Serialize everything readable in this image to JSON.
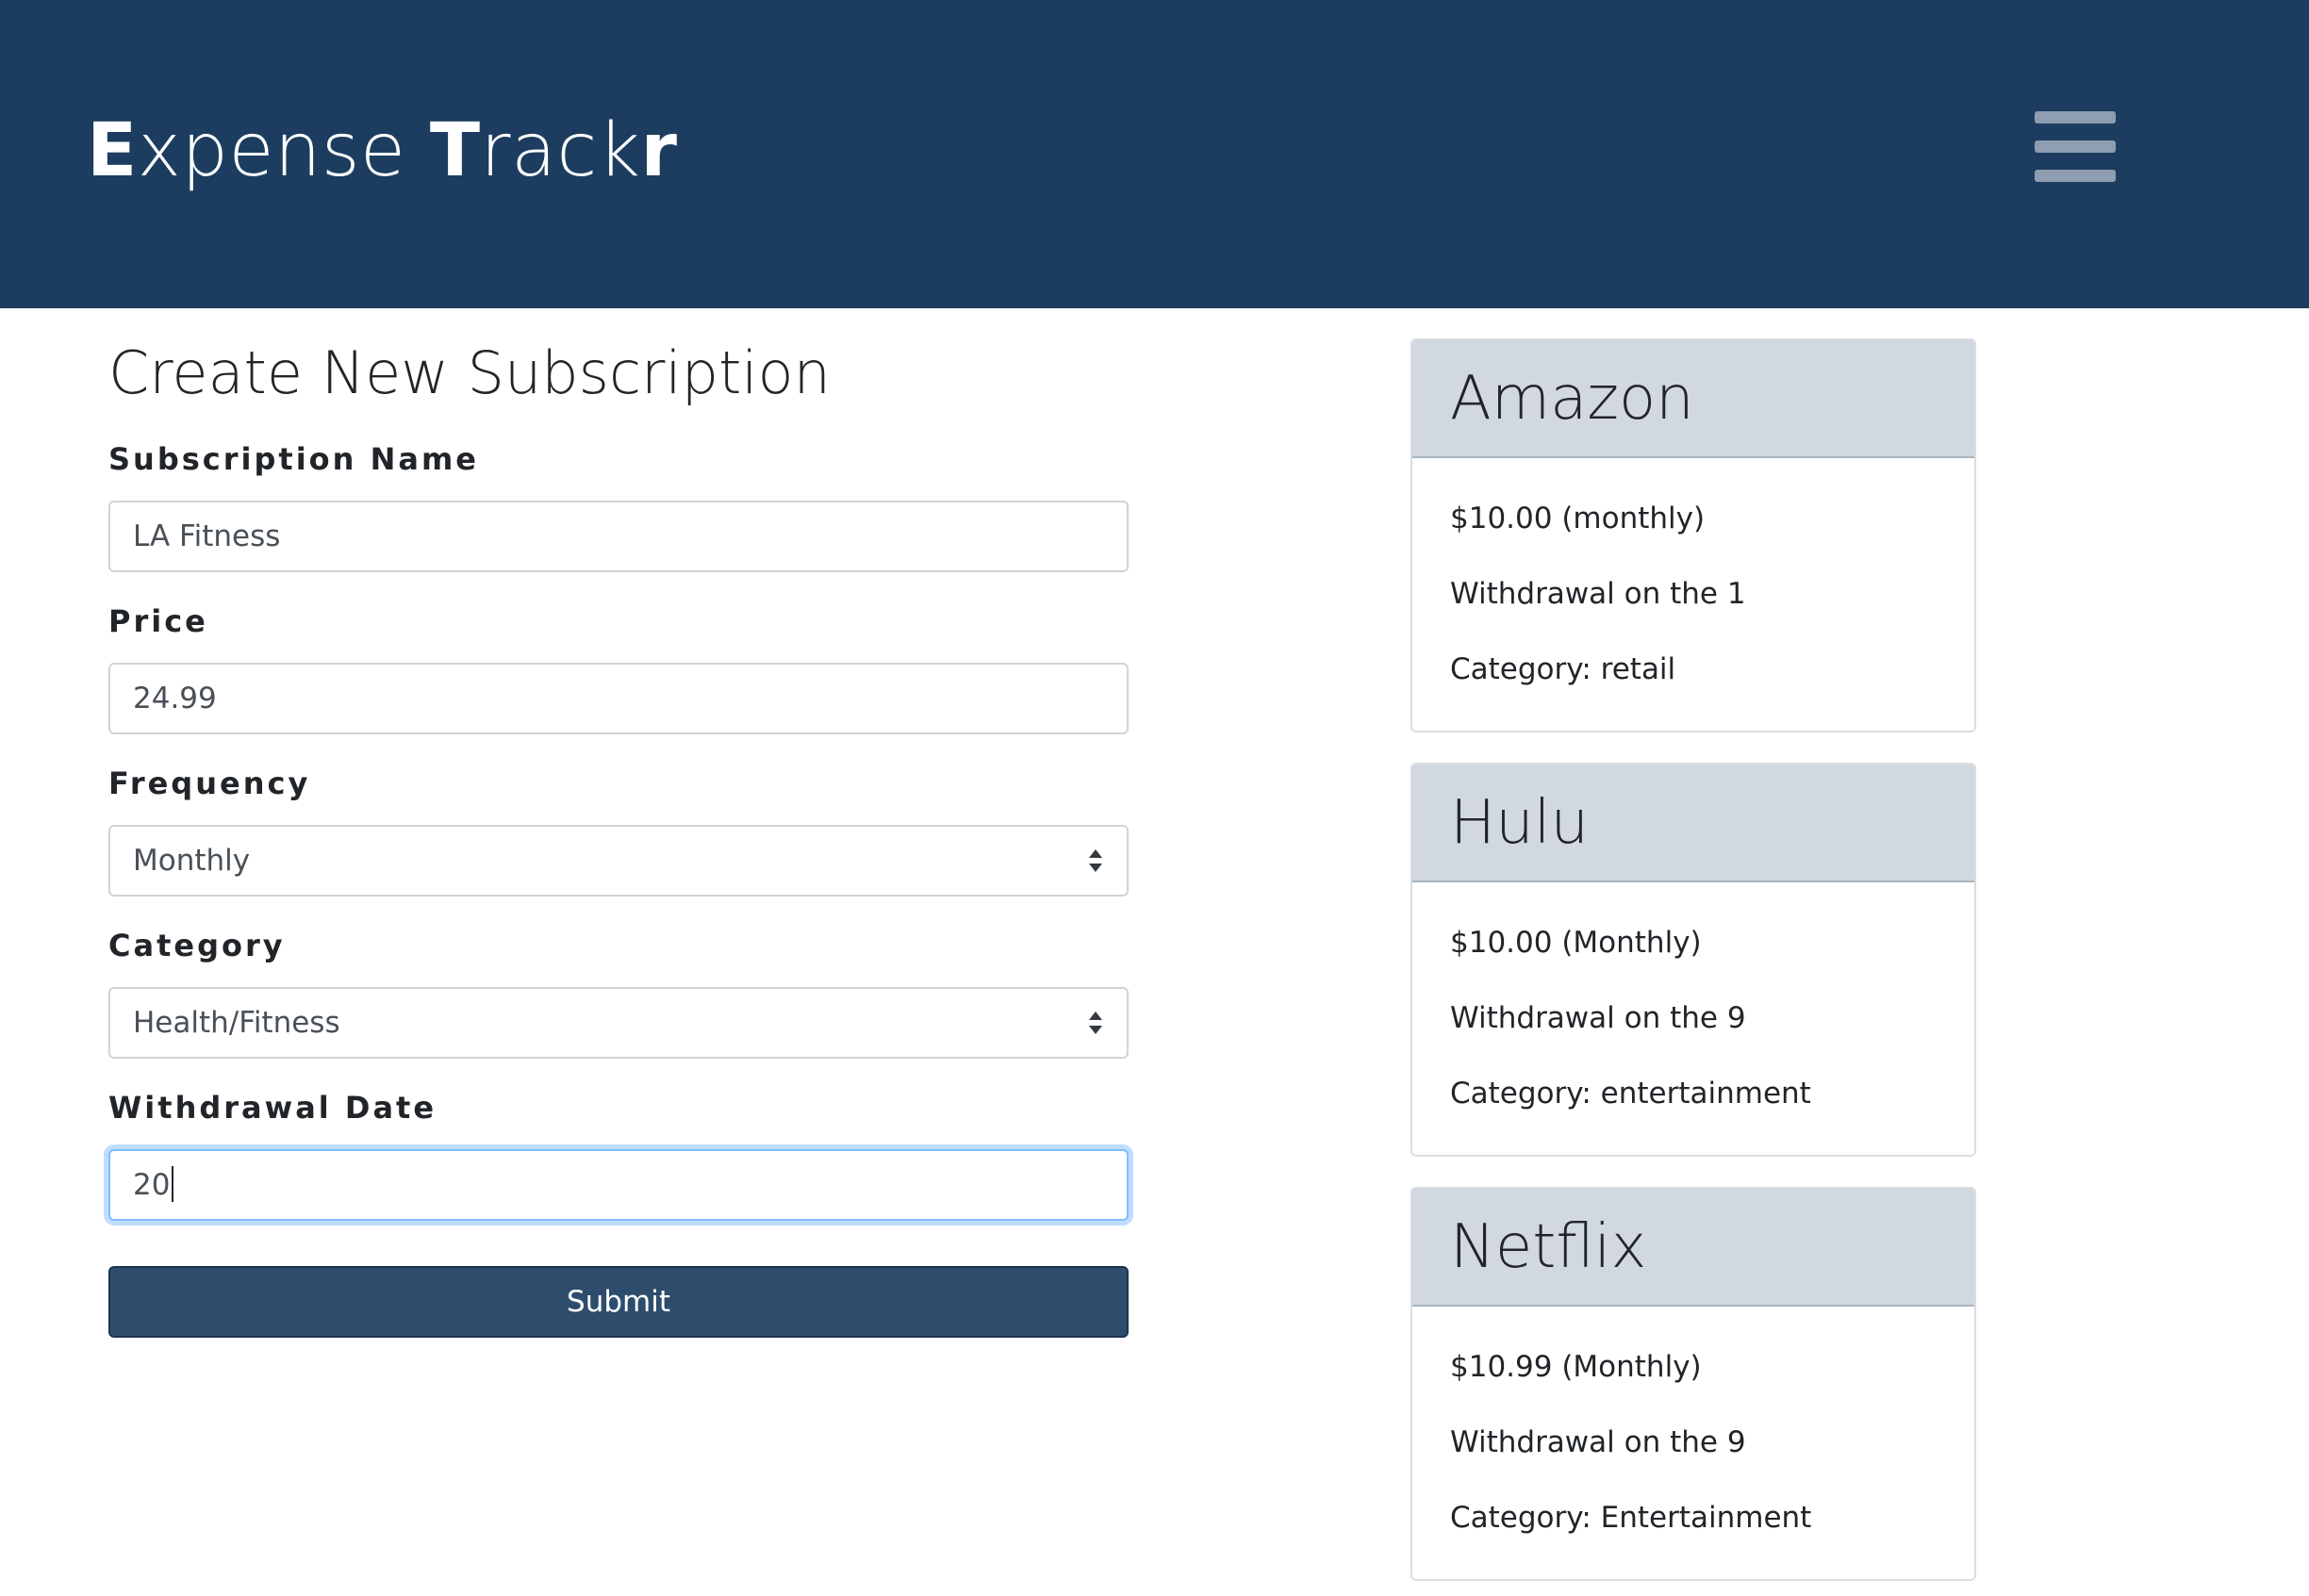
{
  "app": {
    "brand_part1_bold": "E",
    "brand_part2": "xpense ",
    "brand_part3_bold": "T",
    "brand_part4": "rack",
    "brand_part5_bold": "r"
  },
  "form": {
    "title": "Create New Subscription",
    "name_label": "Subscription Name",
    "name_value": "LA Fitness",
    "price_label": "Price",
    "price_value": "24.99",
    "frequency_label": "Frequency",
    "frequency_value": "Monthly",
    "category_label": "Category",
    "category_value": "Health/Fitness",
    "withdrawal_label": "Withdrawal Date",
    "withdrawal_value": "20",
    "submit_label": "Submit"
  },
  "subscriptions": [
    {
      "name": "Amazon",
      "price": "$10.00 (monthly)",
      "withdrawal": "Withdrawal on the 1",
      "category": "Category: retail"
    },
    {
      "name": "Hulu",
      "price": "$10.00 (Monthly)",
      "withdrawal": "Withdrawal on the 9",
      "category": "Category: entertainment"
    },
    {
      "name": "Netflix",
      "price": "$10.99 (Monthly)",
      "withdrawal": "Withdrawal on the 9",
      "category": "Category: Entertainment"
    }
  ],
  "colors": {
    "navbar": "#1c3d5f",
    "submit": "#2e4d6d",
    "card_header": "#d2d8df"
  },
  "icons": {
    "menu": "hamburger-menu-icon"
  }
}
